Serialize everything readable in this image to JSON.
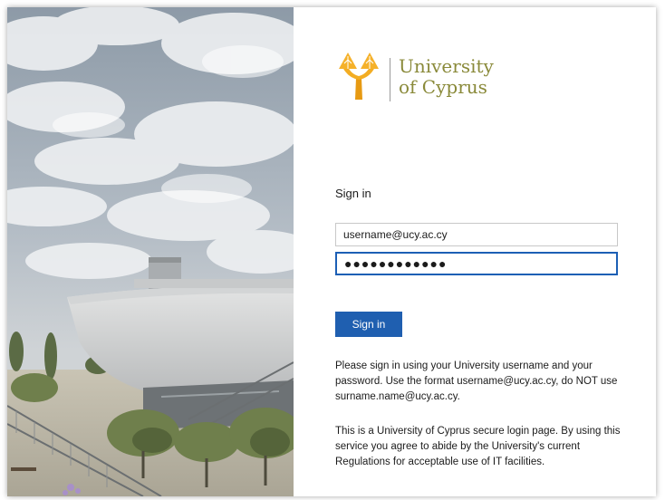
{
  "brand": {
    "icon": "university-tree-logo-icon",
    "name_line1": "University",
    "name_line2": "of Cyprus",
    "accent_color": "#f0a520",
    "text_color": "#8a8a3a"
  },
  "illustration": {
    "icon": "campus-building-photo"
  },
  "login": {
    "heading": "Sign in",
    "username": {
      "value": "username@ucy.ac.cy"
    },
    "password": {
      "masked_value": "●●●●●●●●●●●●"
    },
    "submit_label": "Sign in",
    "button_color": "#1f5fb0"
  },
  "help": {
    "instructions": "Please sign in using your University username and your password. Use the format username@ucy.ac.cy, do NOT use surname.name@ucy.ac.cy.",
    "disclaimer": "This is a University of Cyprus secure login page. By using this service you agree to abide by the University's current Regulations for acceptable use of IT facilities."
  }
}
